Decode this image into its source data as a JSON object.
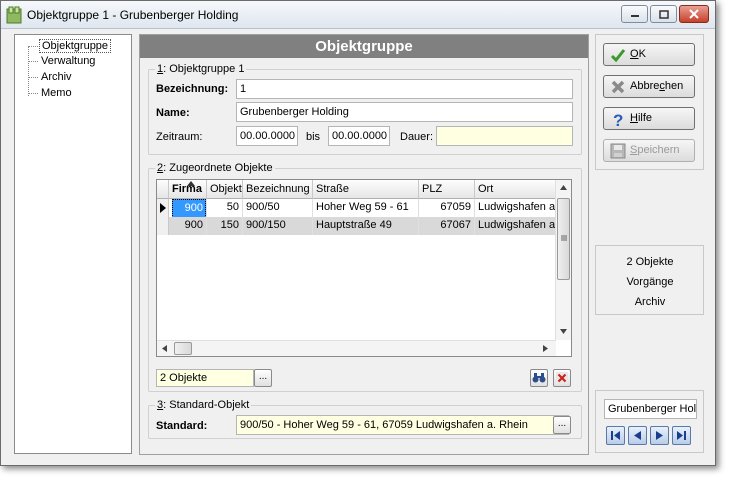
{
  "window": {
    "title": "Objektgruppe 1 - Grubenberger Holding"
  },
  "tree": {
    "items": [
      "Objektgruppe",
      "Verwaltung",
      "Archiv",
      "Memo"
    ]
  },
  "panel": {
    "header": "Objektgruppe",
    "group1": {
      "legend_num": "1",
      "legend_rest": ": Objektgruppe 1",
      "bezeichnung_label": "Bezeichnung:",
      "bezeichnung_value": "1",
      "name_label": "Name:",
      "name_value": "Grubenberger Holding",
      "zeitraum_label": "Zeitraum:",
      "zeitraum_from": "00.00.0000",
      "bis_label": "bis",
      "zeitraum_to": "00.00.0000",
      "dauer_label": "Dauer:",
      "dauer_value": ""
    },
    "group2": {
      "legend_num": "2",
      "legend_rest": ": Zugeordnete Objekte",
      "columns": [
        "Firma",
        "Objekt",
        "Bezeichnung",
        "Straße",
        "PLZ",
        "Ort"
      ],
      "rows": [
        [
          "900",
          "50",
          "900/50",
          "Hoher Weg 59 - 61",
          "67059",
          "Ludwigshafen a."
        ],
        [
          "900",
          "150",
          "900/150",
          "Hauptstraße 49",
          "67067",
          "Ludwigshafen a."
        ]
      ],
      "count_value": "2 Objekte",
      "ellipsis": "..."
    },
    "group3": {
      "legend_num": "3",
      "legend_rest": ": Standard-Objekt",
      "standard_label": "Standard:",
      "standard_value": "900/50 - Hoher Weg 59 - 61, 67059 Ludwigshafen a. Rhein",
      "ellipsis": "..."
    }
  },
  "buttons": {
    "ok": {
      "pre": "",
      "mn": "O",
      "post": "K"
    },
    "abbrechen": {
      "pre": "Abbre",
      "mn": "c",
      "post": "hen"
    },
    "hilfe": {
      "pre": "",
      "mn": "H",
      "post": "ilfe"
    },
    "speichern": {
      "pre": "",
      "mn": "S",
      "post": "peichern"
    }
  },
  "info": {
    "line1": "2 Objekte",
    "line2": "Vorgänge",
    "line3": "Archiv"
  },
  "nav": {
    "record_name": "Grubenberger Hold"
  },
  "colors": {
    "header_bg": "#808080",
    "selected_cell": "#3399ff",
    "field_yellow": "#ffffe1"
  }
}
